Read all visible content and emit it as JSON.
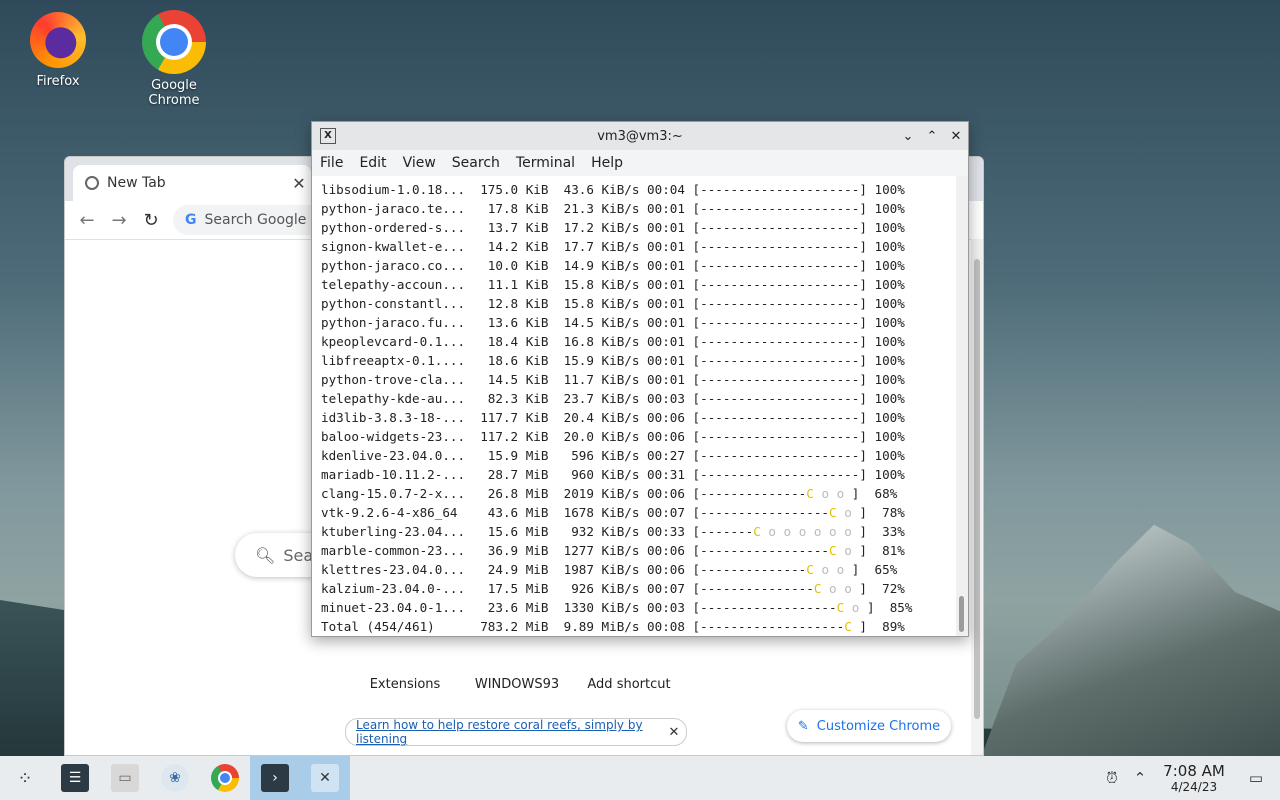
{
  "desktop": {
    "icons": [
      {
        "label": "Firefox"
      },
      {
        "label": "Google Chrome"
      }
    ]
  },
  "chrome": {
    "tab_title": "New Tab",
    "tab_close": "✕",
    "omnibox_placeholder": "Search Google or",
    "search_placeholder": "Sea",
    "shortcuts": [
      {
        "label": "Extensions"
      },
      {
        "label": "WINDOWS93"
      },
      {
        "label": "Add shortcut"
      }
    ],
    "coral_link": "Learn how to help restore coral reefs, simply by listening",
    "customize_label": "Customize Chrome"
  },
  "terminal": {
    "title": "vm3@vm3:~",
    "menu": [
      "File",
      "Edit",
      "View",
      "Search",
      "Terminal",
      "Help"
    ],
    "rows": [
      {
        "name": "libsodium-1.0.18...",
        "size": "175.0 KiB",
        "speed": "43.6 KiB/s",
        "eta": "00:04",
        "bar": "[---------------------]",
        "pct": "100%"
      },
      {
        "name": "python-jaraco.te...",
        "size": "17.8 KiB",
        "speed": "21.3 KiB/s",
        "eta": "00:01",
        "bar": "[---------------------]",
        "pct": "100%"
      },
      {
        "name": "python-ordered-s...",
        "size": "13.7 KiB",
        "speed": "17.2 KiB/s",
        "eta": "00:01",
        "bar": "[---------------------]",
        "pct": "100%"
      },
      {
        "name": "signon-kwallet-e...",
        "size": "14.2 KiB",
        "speed": "17.7 KiB/s",
        "eta": "00:01",
        "bar": "[---------------------]",
        "pct": "100%"
      },
      {
        "name": "python-jaraco.co...",
        "size": "10.0 KiB",
        "speed": "14.9 KiB/s",
        "eta": "00:01",
        "bar": "[---------------------]",
        "pct": "100%"
      },
      {
        "name": "telepathy-accoun...",
        "size": "11.1 KiB",
        "speed": "15.8 KiB/s",
        "eta": "00:01",
        "bar": "[---------------------]",
        "pct": "100%"
      },
      {
        "name": "python-constantl...",
        "size": "12.8 KiB",
        "speed": "15.8 KiB/s",
        "eta": "00:01",
        "bar": "[---------------------]",
        "pct": "100%"
      },
      {
        "name": "python-jaraco.fu...",
        "size": "13.6 KiB",
        "speed": "14.5 KiB/s",
        "eta": "00:01",
        "bar": "[---------------------]",
        "pct": "100%"
      },
      {
        "name": "kpeoplevcard-0.1...",
        "size": "18.4 KiB",
        "speed": "16.8 KiB/s",
        "eta": "00:01",
        "bar": "[---------------------]",
        "pct": "100%"
      },
      {
        "name": "libfreeaptx-0.1....",
        "size": "18.6 KiB",
        "speed": "15.9 KiB/s",
        "eta": "00:01",
        "bar": "[---------------------]",
        "pct": "100%"
      },
      {
        "name": "python-trove-cla...",
        "size": "14.5 KiB",
        "speed": "11.7 KiB/s",
        "eta": "00:01",
        "bar": "[---------------------]",
        "pct": "100%"
      },
      {
        "name": "telepathy-kde-au...",
        "size": "82.3 KiB",
        "speed": "23.7 KiB/s",
        "eta": "00:03",
        "bar": "[---------------------]",
        "pct": "100%"
      },
      {
        "name": "id3lib-3.8.3-18-...",
        "size": "117.7 KiB",
        "speed": "20.4 KiB/s",
        "eta": "00:06",
        "bar": "[---------------------]",
        "pct": "100%"
      },
      {
        "name": "baloo-widgets-23...",
        "size": "117.2 KiB",
        "speed": "20.0 KiB/s",
        "eta": "00:06",
        "bar": "[---------------------]",
        "pct": "100%"
      },
      {
        "name": "kdenlive-23.04.0...",
        "size": "15.9 MiB",
        "speed": "596 KiB/s",
        "eta": "00:27",
        "bar": "[---------------------]",
        "pct": "100%"
      },
      {
        "name": "mariadb-10.11.2-...",
        "size": "28.7 MiB",
        "speed": "960 KiB/s",
        "eta": "00:31",
        "bar": "[---------------------]",
        "pct": "100%"
      },
      {
        "name": "clang-15.0.7-2-x...",
        "size": "26.8 MiB",
        "speed": "2019 KiB/s",
        "eta": "00:06",
        "bar": "[--------------C o o ]",
        "pct": "68%"
      },
      {
        "name": "vtk-9.2.6-4-x86_64",
        "size": "43.6 MiB",
        "speed": "1678 KiB/s",
        "eta": "00:07",
        "bar": "[-----------------C o ]",
        "pct": "78%"
      },
      {
        "name": "ktuberling-23.04...",
        "size": "15.6 MiB",
        "speed": "932 KiB/s",
        "eta": "00:33",
        "bar": "[-------C o o o o o o ]",
        "pct": "33%"
      },
      {
        "name": "marble-common-23...",
        "size": "36.9 MiB",
        "speed": "1277 KiB/s",
        "eta": "00:06",
        "bar": "[-----------------C o ]",
        "pct": "81%"
      },
      {
        "name": "klettres-23.04.0...",
        "size": "24.9 MiB",
        "speed": "1987 KiB/s",
        "eta": "00:06",
        "bar": "[--------------C o o ]",
        "pct": "65%"
      },
      {
        "name": "kalzium-23.04.0-...",
        "size": "17.5 MiB",
        "speed": "926 KiB/s",
        "eta": "00:07",
        "bar": "[---------------C o o ]",
        "pct": "72%"
      },
      {
        "name": "minuet-23.04.0-1...",
        "size": "23.6 MiB",
        "speed": "1330 KiB/s",
        "eta": "00:03",
        "bar": "[------------------C o ]",
        "pct": "85%"
      },
      {
        "name": "Total (454/461)",
        "size": "783.2 MiB",
        "speed": "9.89 MiB/s",
        "eta": "00:08",
        "bar": "[-------------------C ]",
        "pct": "89%"
      }
    ]
  },
  "taskbar": {
    "time": "7:08 AM",
    "date": "4/24/23"
  },
  "colors": {
    "pacman_yellow": "#e3c000",
    "taskbar_active": "#a9cde9",
    "chrome_blue": "#1a73e8"
  }
}
